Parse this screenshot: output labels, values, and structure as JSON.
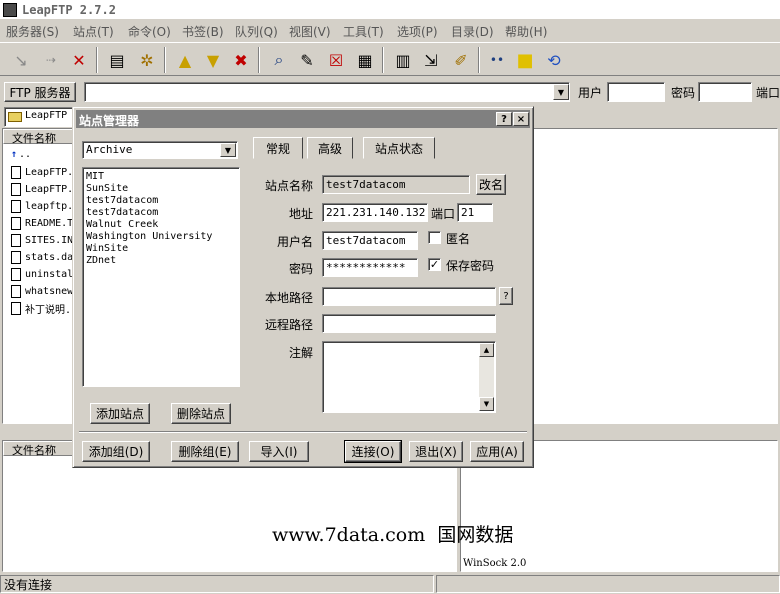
{
  "app": {
    "title": "LeapFTP 2.7.2"
  },
  "menu": [
    "服务器(S)",
    "站点(T)",
    "命令(O)",
    "书签(B)",
    "队列(Q)",
    "视图(V)",
    "工具(T)",
    "选项(P)",
    "目录(D)",
    "帮助(H)"
  ],
  "toolbar_icons": [
    "connect-icon",
    "disconnect-icon",
    "abort-icon",
    "site-manager-icon",
    "bookmark-icon",
    "upload-icon",
    "download-icon",
    "delete-queue-icon",
    "find-icon",
    "edit-icon",
    "cancel-icon",
    "notes-icon",
    "log-icon",
    "transfer-icon",
    "script-icon",
    "dots-icon",
    "folder-icon",
    "refresh-icon"
  ],
  "address": {
    "ftp_button": "FTP 服务器",
    "server_value": "",
    "user_label": "用户",
    "password_label": "密码",
    "port_label": "端口"
  },
  "local_pane": {
    "path": "LeapFTP",
    "column_header": "文件名称",
    "files": [
      "..",
      "LeapFTP.",
      "LeapFTP.",
      "leapftp.",
      "README.T",
      "SITES.IN",
      "stats.da",
      "uninstal",
      "whatsnew",
      "补丁说明."
    ]
  },
  "queue_pane": {
    "column_header": "文件名称"
  },
  "log_pane": {
    "text": "WinSock 2.0"
  },
  "watermark": {
    "text": "www.7data.com  国网数据"
  },
  "status": {
    "text": "没有连接"
  },
  "dialog": {
    "title": "站点管理器",
    "help_glyph": "?",
    "close_glyph": "×",
    "group_select": "Archive",
    "sites": [
      "MIT",
      "SunSite",
      "test7datacom",
      "test7datacom",
      "Walnut Creek",
      "Washington University",
      "WinSite",
      "ZDnet"
    ],
    "tabs": [
      "常规",
      "高级",
      "站点状态"
    ],
    "fields": {
      "site_name_label": "站点名称",
      "site_name": "test7datacom",
      "rename_button": "改名",
      "address_label": "地址",
      "address": "221.231.140.132",
      "port_label": "端口",
      "port": "21",
      "username_label": "用户名",
      "username": "test7datacom",
      "anonymous_label": "匿名",
      "password_label": "密码",
      "password": "************",
      "save_password_label": "保存密码",
      "local_path_label": "本地路径",
      "local_path": "",
      "browse_glyph": "?",
      "remote_path_label": "远程路径",
      "remote_path": "",
      "notes_label": "注解",
      "notes": ""
    },
    "anonymous_checked": false,
    "save_password_checked": true,
    "buttons": {
      "add_site": "添加站点",
      "delete_site": "删除站点",
      "add_group": "添加组(D)",
      "delete_group": "删除组(E)",
      "import": "导入(I)",
      "connect": "连接(O)",
      "exit": "退出(X)",
      "apply": "应用(A)"
    }
  }
}
